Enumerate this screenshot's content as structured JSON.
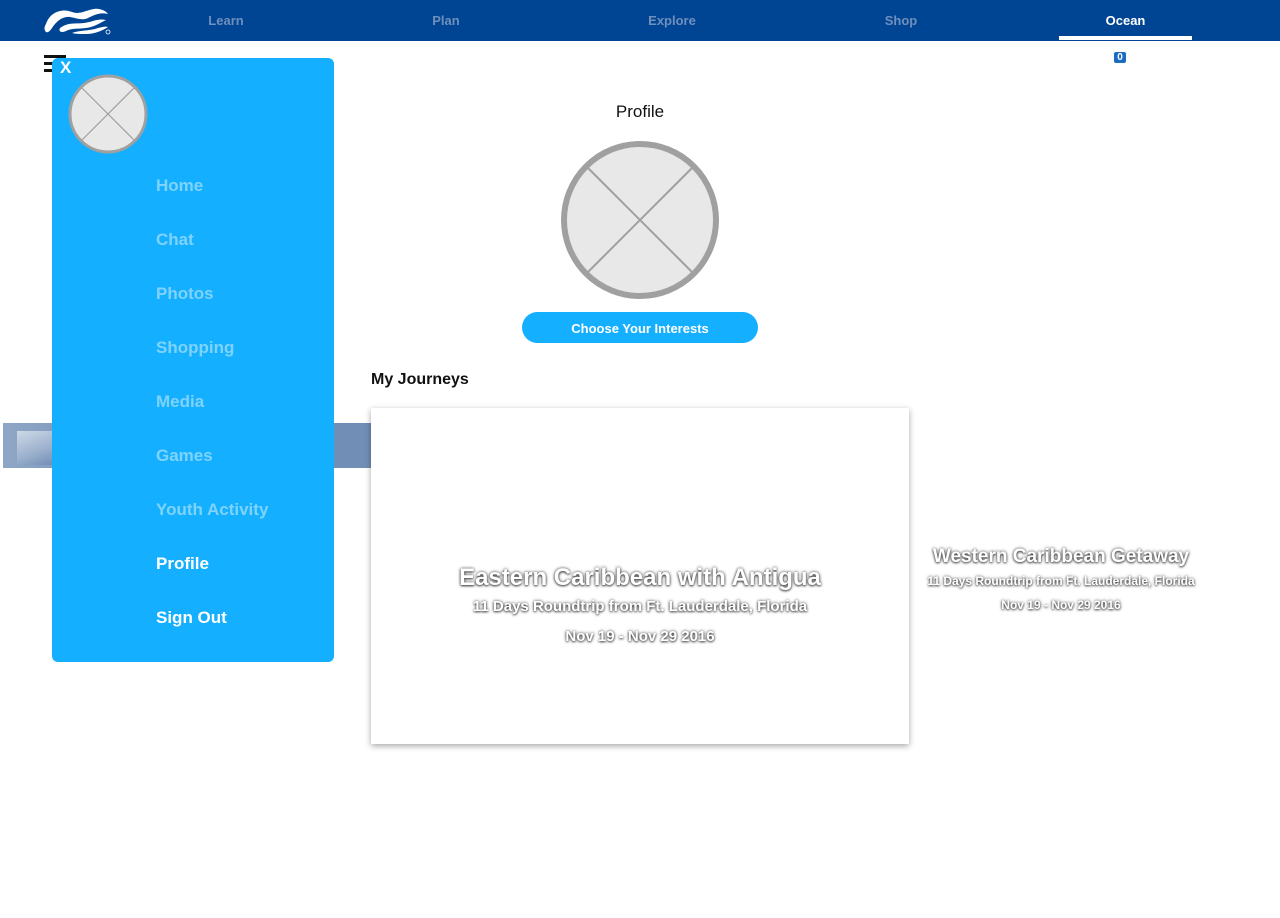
{
  "nav": {
    "logo": "princess-cruises-logo",
    "items": [
      {
        "label": "Learn",
        "active": false
      },
      {
        "label": "Plan",
        "active": false
      },
      {
        "label": "Explore",
        "active": false
      },
      {
        "label": "Shop",
        "active": false
      },
      {
        "label": "Ocean",
        "active": true
      }
    ],
    "cart_count": "0"
  },
  "drawer": {
    "close_label": "X",
    "avatar_icon": "placeholder-image-icon",
    "items": [
      {
        "label": "Home",
        "active": false
      },
      {
        "label": "Chat",
        "active": false
      },
      {
        "label": "Photos",
        "active": false
      },
      {
        "label": "Shopping",
        "active": false
      },
      {
        "label": "Media",
        "active": false
      },
      {
        "label": "Games",
        "active": false
      },
      {
        "label": "Youth Activity",
        "active": false
      },
      {
        "label": "Profile",
        "active": true
      },
      {
        "label": "Sign Out",
        "active": true
      }
    ]
  },
  "profile": {
    "title": "Profile",
    "avatar_icon": "placeholder-image-icon",
    "interests_button": "Choose Your Interests"
  },
  "journeys": {
    "title": "My Journeys",
    "cards": [
      {
        "title": "Eastern Caribbean with Antigua",
        "subtitle": "11 Days Roundtrip from Ft. Lauderdale, Florida",
        "dates": "Nov 19 - Nov 29 2016"
      },
      {
        "title": "Western Caribbean Getaway",
        "subtitle": "11 Days Roundtrip from Ft. Lauderdale, Florida",
        "dates": "Nov 19 - Nov 29 2016"
      }
    ]
  },
  "colors": {
    "nav_bg": "#004593",
    "drawer_bg": "#14b0ff",
    "accent": "#14b0ff",
    "inactive_nav_text": "#6f8fbd",
    "inactive_drawer_text": "#7fd3fb"
  }
}
